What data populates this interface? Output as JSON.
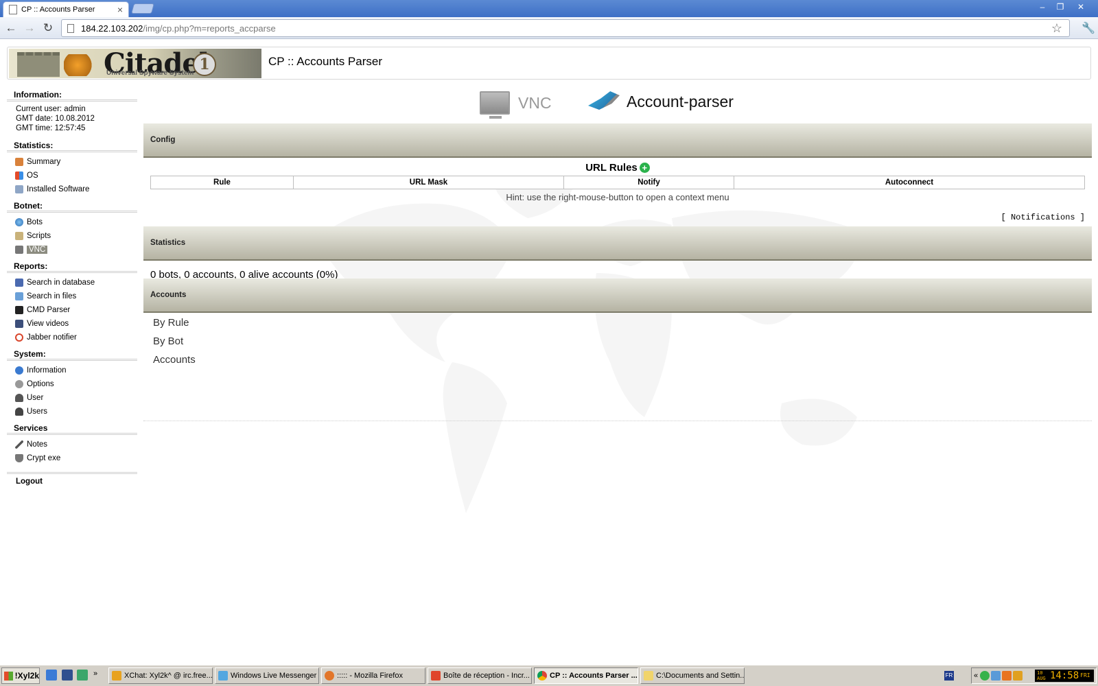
{
  "browser": {
    "tab_title": "CP :: Accounts Parser",
    "url_host": "184.22.103.202",
    "url_path": "/img/cp.php?m=reports_accparse"
  },
  "header": {
    "logo_text": "Citadel",
    "logo_sub": "Universal Spyware System",
    "logo_badge": "1",
    "title": "CP :: Accounts Parser"
  },
  "sidebar": {
    "information": {
      "title": "Information:",
      "lines": [
        "Current user: admin",
        "GMT date: 10.08.2012",
        "GMT time: 12:57:45"
      ]
    },
    "statistics": {
      "title": "Statistics:",
      "items": [
        "Summary",
        "OS",
        "Installed Software"
      ]
    },
    "botnet": {
      "title": "Botnet:",
      "items": [
        "Bots",
        "Scripts",
        "VNC"
      ]
    },
    "reports": {
      "title": "Reports:",
      "items": [
        "Search in database",
        "Search in files",
        "CMD Parser",
        "View videos",
        "Jabber notifier"
      ]
    },
    "system": {
      "title": "System:",
      "items": [
        "Information",
        "Options",
        "User",
        "Users"
      ]
    },
    "services": {
      "title": "Services",
      "items": [
        "Notes",
        "Crypt exe"
      ]
    },
    "logout": "Logout"
  },
  "main": {
    "tabs": [
      "VNC",
      "Account-parser"
    ],
    "config_band": "Config",
    "url_rules_title": "URL Rules",
    "rules_columns": [
      "Rule",
      "URL Mask",
      "Notify",
      "Autoconnect"
    ],
    "hint": "Hint: use the right-mouse-button to open a context menu",
    "notifications_link": "[ Notifications ]",
    "statistics_band": "Statistics",
    "statistics_text": "0 bots, 0 accounts, 0 alive accounts (0%)",
    "accounts_band": "Accounts",
    "account_links": [
      "By Rule",
      "By Bot",
      "Accounts"
    ]
  },
  "taskbar": {
    "start_label": "!Xyl2k",
    "tasks": [
      "XChat: Xyl2k^ @ irc.free...",
      "Windows Live Messenger",
      "::::: - Mozilla Firefox",
      "Boîte de réception - Incr...",
      "CP :: Accounts Parser ...",
      "C:\\Documents and Settin..."
    ],
    "lang": "FR",
    "clock_date": "10 AUG",
    "clock_time": "14:58",
    "clock_day": "FRI"
  },
  "colors": {
    "band_gradient_top": "#e9e9e0",
    "band_gradient_bottom": "#b5b3a3",
    "active_nav_bg": "#8c8c80",
    "add_icon": "#2bb24c"
  }
}
